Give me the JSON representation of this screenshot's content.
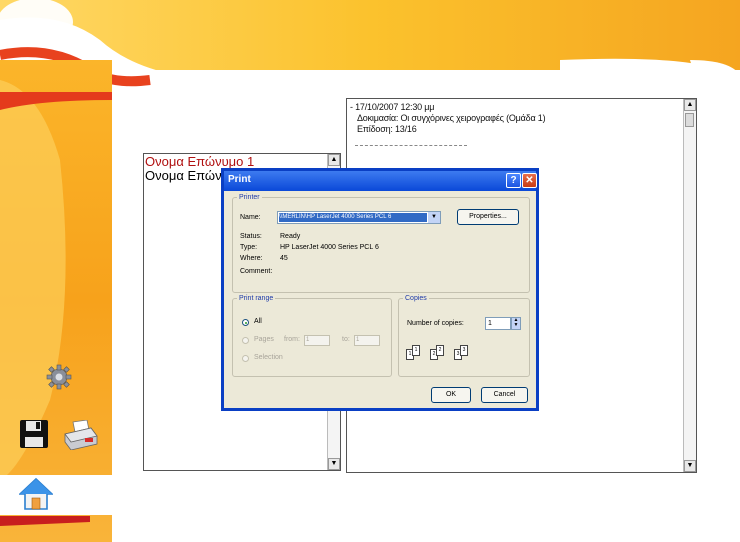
{
  "list_panel": {
    "names": [
      "Ονομα Επώνυμο 1",
      "Ονομα Επών"
    ]
  },
  "text_panel": {
    "lines": [
      "- 17/10/2007 12:30 μμ",
      "Δοκιμασία: Οι συγχόρινες χειρογραφές (Ομάδα 1)",
      "Επίδοση: 13/16"
    ]
  },
  "sidebar": {
    "icons": [
      "gear-icon",
      "save-icon",
      "print-icon",
      "home-icon"
    ]
  },
  "dialog": {
    "title": "Print",
    "help_label": "?",
    "close_label": "✕",
    "printer_group": "Printer",
    "name_label": "Name:",
    "printer_name": "\\\\MERLIN\\HP LaserJet 4000 Series PCL 6",
    "properties_label": "Properties...",
    "status_label": "Status:",
    "status_value": "Ready",
    "type_label": "Type:",
    "type_value": "HP LaserJet 4000 Series PCL 6",
    "where_label": "Where:",
    "where_value": "45",
    "comment_label": "Comment:",
    "print_range_group": "Print range",
    "all_label": "All",
    "pages_label": "Pages",
    "from_label": "from:",
    "from_value": "1",
    "to_label": "to:",
    "to_value": "1",
    "selection_label": "Selection",
    "copies_group": "Copies",
    "number_of_copies_label": "Number of copies:",
    "copies_value": "1",
    "collate_pages": [
      "1",
      "1",
      "2",
      "2",
      "3",
      "3"
    ],
    "ok_label": "OK",
    "cancel_label": "Cancel"
  },
  "colors": {
    "accent_orange": "#f7a21b",
    "accent_red": "#c81e1e",
    "titlebar_blue": "#0a48d8"
  }
}
